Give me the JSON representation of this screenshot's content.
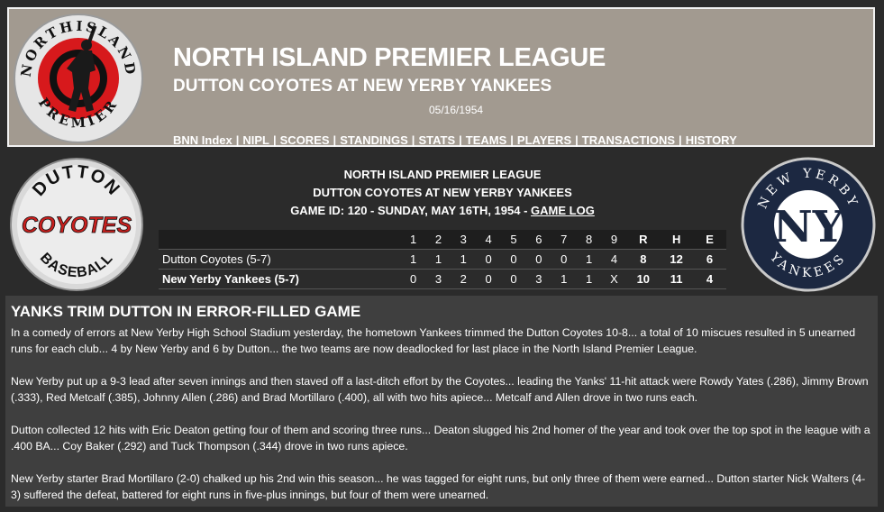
{
  "banner": {
    "league_title": "NORTH ISLAND PREMIER LEAGUE",
    "matchup": "DUTTON COYOTES AT NEW YERBY YANKEES",
    "date": "05/16/1954",
    "logo_text_top": "NORTHISLAND",
    "logo_text_bottom": "PREMIER",
    "nav": [
      {
        "label": "BNN Index"
      },
      {
        "label": "NIPL"
      },
      {
        "label": "SCORES"
      },
      {
        "label": "STANDINGS"
      },
      {
        "label": "STATS"
      },
      {
        "label": "TEAMS"
      },
      {
        "label": "PLAYERS"
      },
      {
        "label": "TRANSACTIONS"
      },
      {
        "label": "HISTORY"
      }
    ]
  },
  "away_logo": {
    "top": "DUTTON",
    "middle": "COYOTES",
    "bottom": "BASEBALL"
  },
  "home_logo": {
    "top": "NEW YERBY",
    "bottom": "YANKEES",
    "mark": "NY"
  },
  "game": {
    "league": "NORTH ISLAND PREMIER LEAGUE",
    "matchup": "DUTTON COYOTES AT NEW YERBY YANKEES",
    "game_id_text": "GAME ID: 120 - SUNDAY, MAY 16TH, 1954 - ",
    "game_log_label": "GAME LOG"
  },
  "linescore": {
    "headers": [
      "1",
      "2",
      "3",
      "4",
      "5",
      "6",
      "7",
      "8",
      "9",
      "R",
      "H",
      "E"
    ],
    "away": {
      "team": "Dutton Coyotes (5-7)",
      "innings": [
        "1",
        "1",
        "1",
        "0",
        "0",
        "0",
        "0",
        "1",
        "4"
      ],
      "r": "8",
      "h": "12",
      "e": "6"
    },
    "home": {
      "team": "New Yerby Yankees (5-7)",
      "innings": [
        "0",
        "3",
        "2",
        "0",
        "0",
        "3",
        "1",
        "1",
        "X"
      ],
      "r": "10",
      "h": "11",
      "e": "4"
    }
  },
  "story": {
    "headline": "YANKS TRIM DUTTON IN ERROR-FILLED GAME",
    "paragraphs": [
      "In a comedy of errors at New Yerby High School Stadium yesterday, the hometown Yankees trimmed the Dutton Coyotes 10-8... a total of 10 miscues resulted in 5 unearned runs for each club... 4 by New Yerby and 6 by Dutton... the two teams are now deadlocked for last place in the North Island Premier League.",
      "New Yerby put up a 9-3 lead after seven innings and then staved off a last-ditch effort by the Coyotes... leading the Yanks' 11-hit attack were Rowdy Yates (.286), Jimmy Brown (.333), Red Metcalf (.385), Johnny Allen (.286) and Brad Mortillaro (.400), all with two hits apiece... Metcalf and Allen drove in two runs each.",
      "Dutton collected 12 hits with Eric Deaton getting four of them and scoring three runs... Deaton slugged his 2nd homer of the year and took over the top spot in the league with a .400 BA... Coy Baker (.292) and Tuck Thompson (.344) drove in two runs apiece.",
      "New Yerby starter Brad Mortillaro (2-0) chalked up his 2nd win this season... he was tagged for eight runs, but only three of them were earned... Dutton starter Nick Walters (4-3) suffered the defeat, battered for eight runs in five-plus innings, but four of them were unearned."
    ]
  },
  "colors": {
    "page_bg": "#2b2b2b",
    "banner_bg": "#a29a90",
    "story_bg": "#3f3f3f",
    "coyotes_red": "#c8201e",
    "yankees_navy": "#1c2841"
  }
}
